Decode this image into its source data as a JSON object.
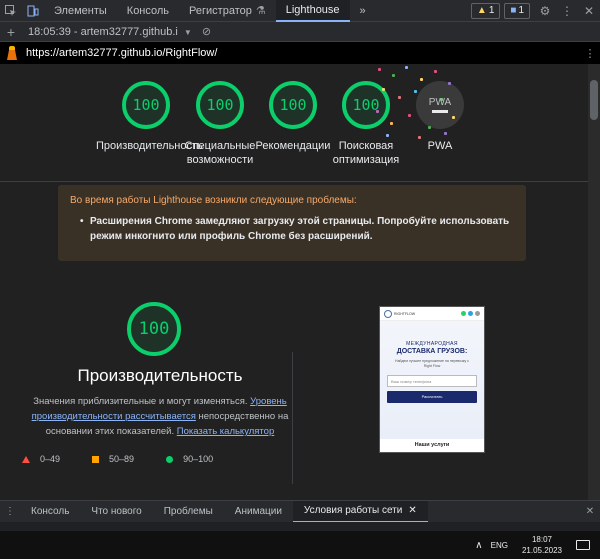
{
  "devtools": {
    "tabs": [
      {
        "label": "Элементы"
      },
      {
        "label": "Консоль"
      },
      {
        "label": "Регистратор"
      },
      {
        "label": "Lighthouse"
      }
    ],
    "more_tabs_glyph": "»",
    "warnings_count": "1",
    "messages_count": "1"
  },
  "toolbar": {
    "run_label": "18:05:39 - artem32777.github.i"
  },
  "urlbar": {
    "url": "https://artem32777.github.io/RightFlow/"
  },
  "scores": [
    {
      "value": "100",
      "label": "Производительность",
      "color": "#0cce6b"
    },
    {
      "value": "100",
      "label": "Специальные возможности",
      "color": "#0cce6b"
    },
    {
      "value": "100",
      "label": "Рекомендации",
      "color": "#0cce6b"
    },
    {
      "value": "100",
      "label": "Поисковая оптимизация",
      "color": "#0cce6b"
    },
    {
      "value": "PWA",
      "label": "PWA"
    }
  ],
  "warning": {
    "heading": "Во время работы Lighthouse возникли следующие проблемы:",
    "item": "Расширения Chrome замедляют загрузку этой страницы. Попробуйте использовать режим инкогнито или профиль Chrome без расширений."
  },
  "performance": {
    "score": "100",
    "title": "Производительность",
    "desc_before": "Значения приблизительные и могут изменяться. ",
    "desc_link": "Уровень производительности рассчитывается",
    "desc_middle": " непосредственно на основании этих показателей. ",
    "desc_calc_link": "Показать калькулятор"
  },
  "legend": [
    {
      "range": "0–49",
      "color": "#ff4e42"
    },
    {
      "range": "50–89",
      "color": "#ffa400"
    },
    {
      "range": "90–100",
      "color": "#0cce6b"
    }
  ],
  "phone": {
    "name": "RIGHTFLOW",
    "line1": "МЕЖДУНАРОДНАЯ",
    "line2": "ДОСТАВКА ГРУЗОВ:",
    "line3": "Найдем лучшее предложение на перевозку с Right Flow",
    "input_placeholder": "Ваш номер телефона",
    "button": "Рассчитать",
    "footer": "Наши услуги"
  },
  "drawer": {
    "tabs": [
      {
        "label": "Консоль"
      },
      {
        "label": "Что нового"
      },
      {
        "label": "Проблемы"
      },
      {
        "label": "Анимации"
      },
      {
        "label": "Условия работы сети"
      }
    ],
    "close_glyph": "✕"
  },
  "taskbar": {
    "lang": "ENG",
    "time": "18:07",
    "date": "21.05.2023"
  }
}
